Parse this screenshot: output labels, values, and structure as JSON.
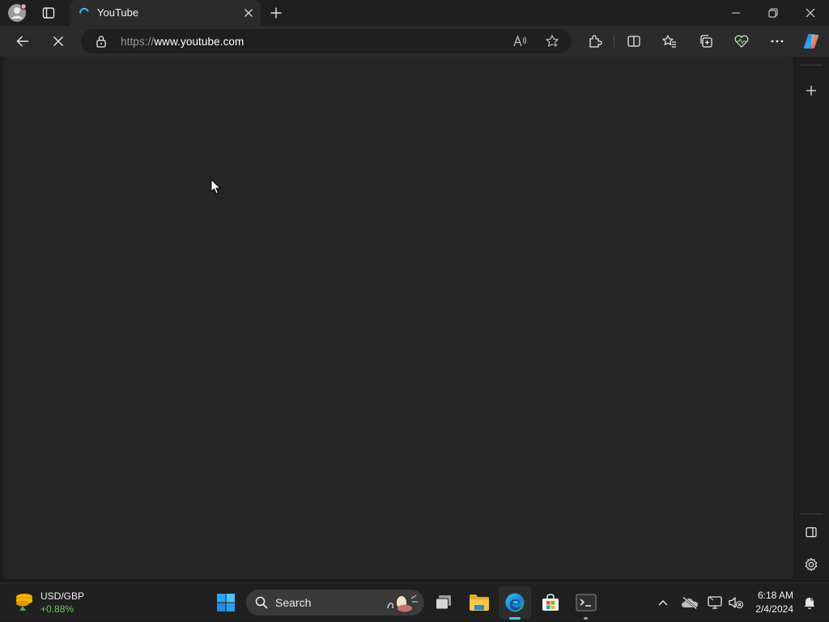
{
  "browser": {
    "tab": {
      "title": "YouTube",
      "close_icon": "close-icon",
      "favicon": "loading-spinner-icon"
    },
    "new_tab_icon": "plus-icon",
    "window_controls": [
      "minimize-icon",
      "restore-icon",
      "close-icon"
    ],
    "address_bar": {
      "url_scheme": "https://",
      "url_host": "www.youtube.com",
      "lock_icon": "lock-icon"
    },
    "toolbar_icons": [
      "back-arrow-icon",
      "stop-loading-icon",
      "read-aloud-icon",
      "favorite-star-icon",
      "extensions-icon",
      "split-screen-icon",
      "favorites-icon",
      "collections-icon",
      "browser-essentials-icon",
      "more-menu-icon",
      "copilot-icon"
    ],
    "sidebar_icons": [
      "add-plus-icon",
      "hide-sidebar-icon",
      "settings-gear-icon"
    ]
  },
  "taskbar": {
    "widget": {
      "name": "USD/GBP",
      "change": "+0.88%"
    },
    "search": {
      "placeholder": "Search"
    },
    "apps": [
      "start-windows-icon",
      "task-view-icon",
      "file-explorer-icon",
      "edge-icon",
      "store-icon",
      "terminal-icon"
    ],
    "tray_icons": [
      "chevron-up-icon",
      "onedrive-icon",
      "network-icon",
      "volume-muted-icon",
      "notification-icon"
    ],
    "clock": {
      "time": "6:18 AM",
      "date": "2/4/2024"
    }
  },
  "colors": {
    "accent": "#4cc2ff",
    "positive": "#6ccb5f",
    "chrome_bg": "#1f1f1f",
    "toolbar_bg": "#2b2b2b",
    "page_bg": "#252525"
  }
}
